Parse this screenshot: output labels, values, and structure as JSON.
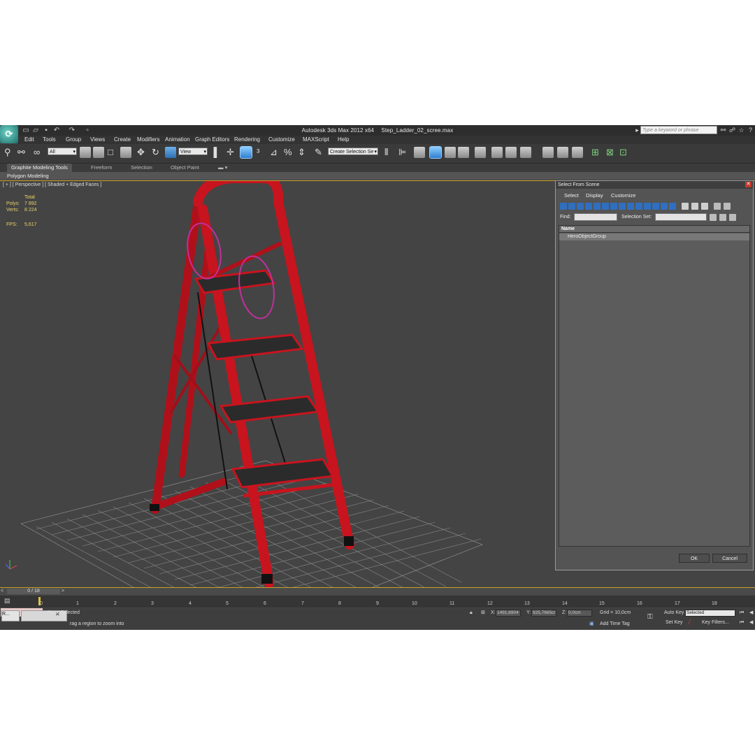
{
  "titlebar": {
    "app_name": "Autodesk 3ds Max  2012 x64",
    "file_name": "Step_Ladder_02_scree.max",
    "search_placeholder": "Type a keyword or phrase"
  },
  "menu": [
    "Edit",
    "Tools",
    "Group",
    "Views",
    "Create",
    "Modifiers",
    "Animation",
    "Graph Editors",
    "Rendering",
    "Customize",
    "MAXScript",
    "Help"
  ],
  "toolbar": {
    "filter_value": "All",
    "coord_value": "View",
    "selection_set_value": "Create Selection Se"
  },
  "ribbon": {
    "tabs": [
      "Graphite Modeling Tools",
      "Freeform",
      "Selection",
      "Object Paint"
    ],
    "panel_label": "Polygon Modeling"
  },
  "viewport": {
    "label": "[ + ] [ Perspective ] [ Shaded + Edged Faces ]",
    "stats": {
      "total_label": "Total",
      "polys_label": "Polys:",
      "polys_value": "7 892",
      "verts_label": "Verts:",
      "verts_value": "8 224",
      "fps_label": "FPS:",
      "fps_value": "5,617"
    }
  },
  "dialog": {
    "title": "Select From Scene",
    "menu": [
      "Select",
      "Display",
      "Customize"
    ],
    "find_label": "Find:",
    "selection_set_label": "Selection Set:",
    "column_name": "Name",
    "rows": [
      "HeroObjectGroup"
    ],
    "ok_label": "OK",
    "cancel_label": "Cancel"
  },
  "timeline": {
    "frame_display": "0 / 18",
    "ticks": [
      "0",
      "1",
      "2",
      "3",
      "4",
      "5",
      "6",
      "7",
      "8",
      "9",
      "10",
      "11",
      "12",
      "13",
      "14",
      "15",
      "16",
      "17",
      "18"
    ]
  },
  "status": {
    "selection_text": "None Selected",
    "prompt_text": "rag a region to zoom into",
    "x_label": "X:",
    "x_value": "1491,6904",
    "y_label": "Y:",
    "y_value": "925,7665cr",
    "z_label": "Z:",
    "z_value": "0,0cm",
    "grid_text": "Grid = 10,0cm",
    "add_time_tag": "Add Time Tag",
    "auto_key": "Auto Key",
    "selected_value": "Selected",
    "set_key": "Set Key",
    "key_filters": "Key Filters...",
    "taskbar_label": "R..."
  },
  "colors": {
    "ladder_red": "#c8141e",
    "viewport_bg": "#444444",
    "highlight_circle": "#c0309c"
  }
}
